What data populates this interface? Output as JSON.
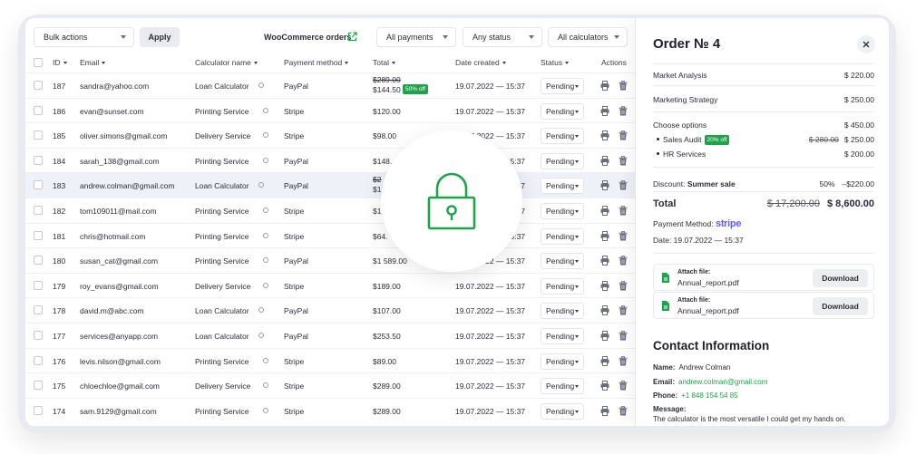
{
  "toolbar": {
    "bulk_actions": "Bulk actions",
    "apply_label": "Apply",
    "woo_link": "WooCommerce orders",
    "filter_payments": "All payments",
    "filter_status": "Any status",
    "filter_calculators": "All calculators"
  },
  "table": {
    "columns": {
      "id": "ID",
      "email": "Email",
      "calculator": "Calculator name",
      "payment": "Payment method",
      "total": "Total",
      "date": "Date created",
      "status": "Status",
      "actions": "Actions"
    },
    "rows": [
      {
        "id": "187",
        "email": "sandra@yahoo.com",
        "calculator": "Loan Calculator",
        "payment": "PayPal",
        "total_old": "$289.00",
        "total": "$144.50",
        "discount": "50% off",
        "date": "19.07.2022 — 15:37",
        "status": "Pending"
      },
      {
        "id": "186",
        "email": "evan@sunset.com",
        "calculator": "Printing Service",
        "payment": "Stripe",
        "total": "$120.00",
        "date": "19.07.2022 — 15:37",
        "status": "Pending"
      },
      {
        "id": "185",
        "email": "oliver.simons@gmail.com",
        "calculator": "Delivery Service",
        "payment": "Stripe",
        "total": "$98.00",
        "date": "19.07.2022 — 15:37",
        "status": "Pending"
      },
      {
        "id": "184",
        "email": "sarah_138@gmail.com",
        "calculator": "Printing Service",
        "payment": "PayPal",
        "total": "$148.",
        "date": "19.07.2022 — 15:37",
        "status": "Pending"
      },
      {
        "id": "183",
        "email": "andrew.colman@gmail.com",
        "calculator": "Loan Calculator",
        "payment": "PayPal",
        "total_old": "$2",
        "total": "$1",
        "date": "19.07.2022 — 15:37",
        "status": "Pending"
      },
      {
        "id": "182",
        "email": "tom109011@mail.com",
        "calculator": "Printing Service",
        "payment": "Stripe",
        "total": "$1",
        "date": "19.07.2022 — 15:37",
        "status": "Pending"
      },
      {
        "id": "181",
        "email": "chris@hotmail.com",
        "calculator": "Printing Service",
        "payment": "Stripe",
        "total": "$64.",
        "date": "19.07.2022 — 15:37",
        "status": "Pending"
      },
      {
        "id": "180",
        "email": "susan_cat@gmail.com",
        "calculator": "Printing Service",
        "payment": "PayPal",
        "total": "$1 589.00",
        "date": "19.07.2022 — 15:37",
        "status": "Pending"
      },
      {
        "id": "179",
        "email": "roy_evans@gmail.com",
        "calculator": "Delivery Service",
        "payment": "Stripe",
        "total": "$189.00",
        "date": "19.07.2022 — 15:37",
        "status": "Pending"
      },
      {
        "id": "178",
        "email": "david.m@abc.com",
        "calculator": "Loan Calculator",
        "payment": "PayPal",
        "total": "$107.00",
        "date": "19.07.2022 — 15:37",
        "status": "Pending"
      },
      {
        "id": "177",
        "email": "services@anyapp.com",
        "calculator": "Loan Calculator",
        "payment": "PayPal",
        "total": "$253.50",
        "date": "19.07.2022 — 15:37",
        "status": "Pending"
      },
      {
        "id": "176",
        "email": "levis.nilson@gmail.com",
        "calculator": "Printing Service",
        "payment": "Stripe",
        "total": "$89.00",
        "date": "19.07.2022 — 15:37",
        "status": "Pending"
      },
      {
        "id": "175",
        "email": "chloechloe@gmail.com",
        "calculator": "Delivery Service",
        "payment": "Stripe",
        "total": "$289.00",
        "date": "19.07.2022 — 15:37",
        "status": "Pending"
      },
      {
        "id": "174",
        "email": "sam.9129@gmail.com",
        "calculator": "Printing Service",
        "payment": "Stripe",
        "total": "$289.00",
        "date": "19.07.2022 — 15:37",
        "status": "Pending"
      }
    ]
  },
  "panel": {
    "title": "Order № 4",
    "items": [
      {
        "label": "Market Analysis",
        "value": "$ 220.00"
      },
      {
        "label": "Marketing Strategy",
        "value": "$ 250.00"
      }
    ],
    "choose_options": {
      "label": "Choose options",
      "value": "$ 450.00"
    },
    "sub_items": [
      {
        "label": "Sales Audit",
        "badge": "20% off",
        "old": "$ 280.00",
        "value": "$ 250.00"
      },
      {
        "label": "HR Services",
        "value": "$ 200.00"
      }
    ],
    "discount": {
      "label": "Discount:",
      "name": "Summer sale",
      "percent": "50%",
      "value": "–$220.00"
    },
    "total": {
      "label": "Total",
      "old": "$ 17,200.00",
      "value": "$ 8,600.00"
    },
    "payment_method_label": "Payment Method:",
    "payment_method_value": "stripe",
    "date": "Date: 19.07.2022 — 15:37",
    "files": [
      {
        "caption": "Attach file:",
        "name": "Annual_report.pdf",
        "button": "Download"
      },
      {
        "caption": "Attach file:",
        "name": "Annual_report.pdf",
        "button": "Download"
      }
    ],
    "contact": {
      "title": "Contact Information",
      "name_label": "Name:",
      "name": "Andrew Colman",
      "email_label": "Email:",
      "email": "andrew.colman@gmail.com",
      "phone_label": "Phone:",
      "phone": "+1 848 154 54 85",
      "message_label": "Message:",
      "message": "The calculator is the most versatile I could get my hands on."
    }
  },
  "colors": {
    "accent_green": "#1fa34a",
    "stripe_purple": "#635bff"
  }
}
